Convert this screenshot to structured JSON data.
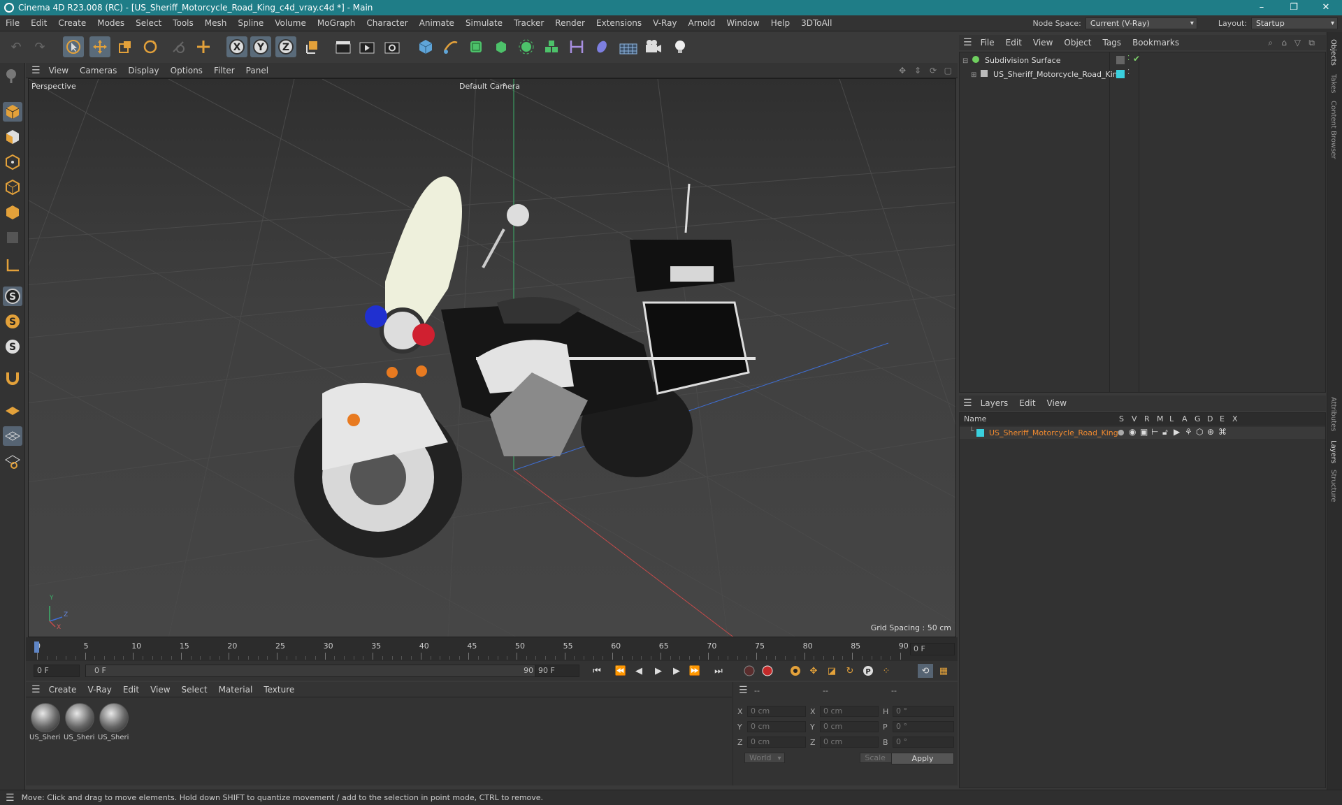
{
  "window": {
    "title": "Cinema 4D R23.008 (RC) - [US_Sheriff_Motorcycle_Road_King_c4d_vray.c4d *] - Main",
    "buttons": [
      "–",
      "❐",
      "✕"
    ]
  },
  "menubar": {
    "items": [
      "File",
      "Edit",
      "Create",
      "Modes",
      "Select",
      "Tools",
      "Mesh",
      "Spline",
      "Volume",
      "MoGraph",
      "Character",
      "Animate",
      "Simulate",
      "Tracker",
      "Render",
      "Extensions",
      "V-Ray",
      "Arnold",
      "Window",
      "Help",
      "3DToAll"
    ],
    "node_space_label": "Node Space:",
    "node_space_value": "Current (V-Ray)",
    "layout_label": "Layout:",
    "layout_value": "Startup"
  },
  "viewport": {
    "menu": [
      "View",
      "Cameras",
      "Display",
      "Options",
      "Filter",
      "Panel"
    ],
    "name": "Perspective",
    "camera": "Default Camera",
    "grid_spacing": "Grid Spacing : 50 cm",
    "axes": {
      "x": "X",
      "y": "Y",
      "z": "Z"
    }
  },
  "timeline": {
    "ticks": [
      "0",
      "5",
      "10",
      "15",
      "20",
      "25",
      "30",
      "35",
      "40",
      "45",
      "50",
      "55",
      "60",
      "65",
      "70",
      "75",
      "80",
      "85",
      "90"
    ],
    "current_frame": "0 F",
    "start_field": "0 F",
    "range_start": "0 F",
    "range_end": "90 F",
    "end_field": "90 F"
  },
  "materials": {
    "menu": [
      "Create",
      "V-Ray",
      "Edit",
      "View",
      "Select",
      "Material",
      "Texture"
    ],
    "items": [
      "US_Sheri",
      "US_Sheri",
      "US_Sheri"
    ]
  },
  "coordinates": {
    "headers": [
      "--",
      "--",
      "--"
    ],
    "rows": [
      {
        "a": "X",
        "av": "0 cm",
        "b": "X",
        "bv": "0 cm",
        "c": "H",
        "cv": "0 °"
      },
      {
        "a": "Y",
        "av": "0 cm",
        "b": "Y",
        "bv": "0 cm",
        "c": "P",
        "cv": "0 °"
      },
      {
        "a": "Z",
        "av": "0 cm",
        "b": "Z",
        "bv": "0 cm",
        "c": "B",
        "cv": "0 °"
      }
    ],
    "world": "World",
    "scale": "Scale",
    "apply": "Apply"
  },
  "objects": {
    "menu": [
      "File",
      "Edit",
      "View",
      "Object",
      "Tags",
      "Bookmarks"
    ],
    "items": [
      {
        "name": "Subdivision Surface",
        "color": "#7fd36b"
      },
      {
        "name": "US_Sheriff_Motorcycle_Road_King",
        "color": "#3ad0de"
      }
    ]
  },
  "layers": {
    "menu": [
      "Layers",
      "Edit",
      "View"
    ],
    "column_name": "Name",
    "columns": [
      "S",
      "V",
      "R",
      "M",
      "L",
      "A",
      "G",
      "D",
      "E",
      "X"
    ],
    "items": [
      {
        "name": "US_Sheriff_Motorcycle_Road_King",
        "color": "#3ad0de"
      }
    ]
  },
  "side_tabs": [
    "Objects",
    "Takes",
    "Content Browser",
    "Attributes",
    "Layers",
    "Structure"
  ],
  "status": "Move: Click and drag to move elements. Hold down SHIFT to quantize movement / add to the selection in point mode, CTRL to remove."
}
